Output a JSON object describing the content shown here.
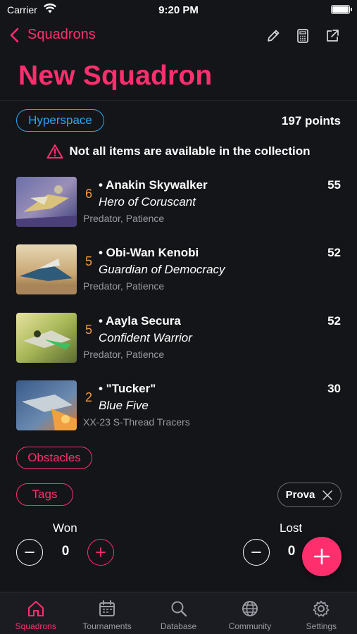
{
  "status_bar": {
    "carrier": "Carrier",
    "time": "9:20 PM"
  },
  "nav": {
    "back_label": "Squadrons",
    "icons": [
      "pencil-icon",
      "calculator-icon",
      "share-icon"
    ]
  },
  "page_title": "New Squadron",
  "format": "Hyperspace",
  "points": "197 points",
  "warning": "Not all items are available in the collection",
  "pilots": [
    {
      "skill": "6",
      "name": "• Anakin Skywalker",
      "title": "Hero of Coruscant",
      "upgrades": "Predator, Patience",
      "cost": "55"
    },
    {
      "skill": "5",
      "name": "• Obi-Wan Kenobi",
      "title": "Guardian of Democracy",
      "upgrades": "Predator, Patience",
      "cost": "52"
    },
    {
      "skill": "5",
      "name": "• Aayla Secura",
      "title": "Confident Warrior",
      "upgrades": "Predator, Patience",
      "cost": "52"
    },
    {
      "skill": "2",
      "name": "• \"Tucker\"",
      "title": "Blue Five",
      "upgrades": "XX-23 S-Thread Tracers",
      "cost": "30"
    }
  ],
  "obstacles_label": "Obstacles",
  "tags_label": "Tags",
  "tag_chip": "Prova",
  "won": {
    "label": "Won",
    "value": "0"
  },
  "lost": {
    "label": "Lost",
    "value": "0"
  },
  "tabs": [
    {
      "label": "Squadrons",
      "icon": "home-icon",
      "active": true
    },
    {
      "label": "Tournaments",
      "icon": "calendar-icon",
      "active": false
    },
    {
      "label": "Database",
      "icon": "search-icon",
      "active": false
    },
    {
      "label": "Community",
      "icon": "globe-icon",
      "active": false
    },
    {
      "label": "Settings",
      "icon": "gear-icon",
      "active": false
    }
  ],
  "colors": {
    "accent": "#ff2f6e",
    "format_blue": "#2aa8f2",
    "skill_orange": "#f39a3d",
    "background": "#141519"
  }
}
